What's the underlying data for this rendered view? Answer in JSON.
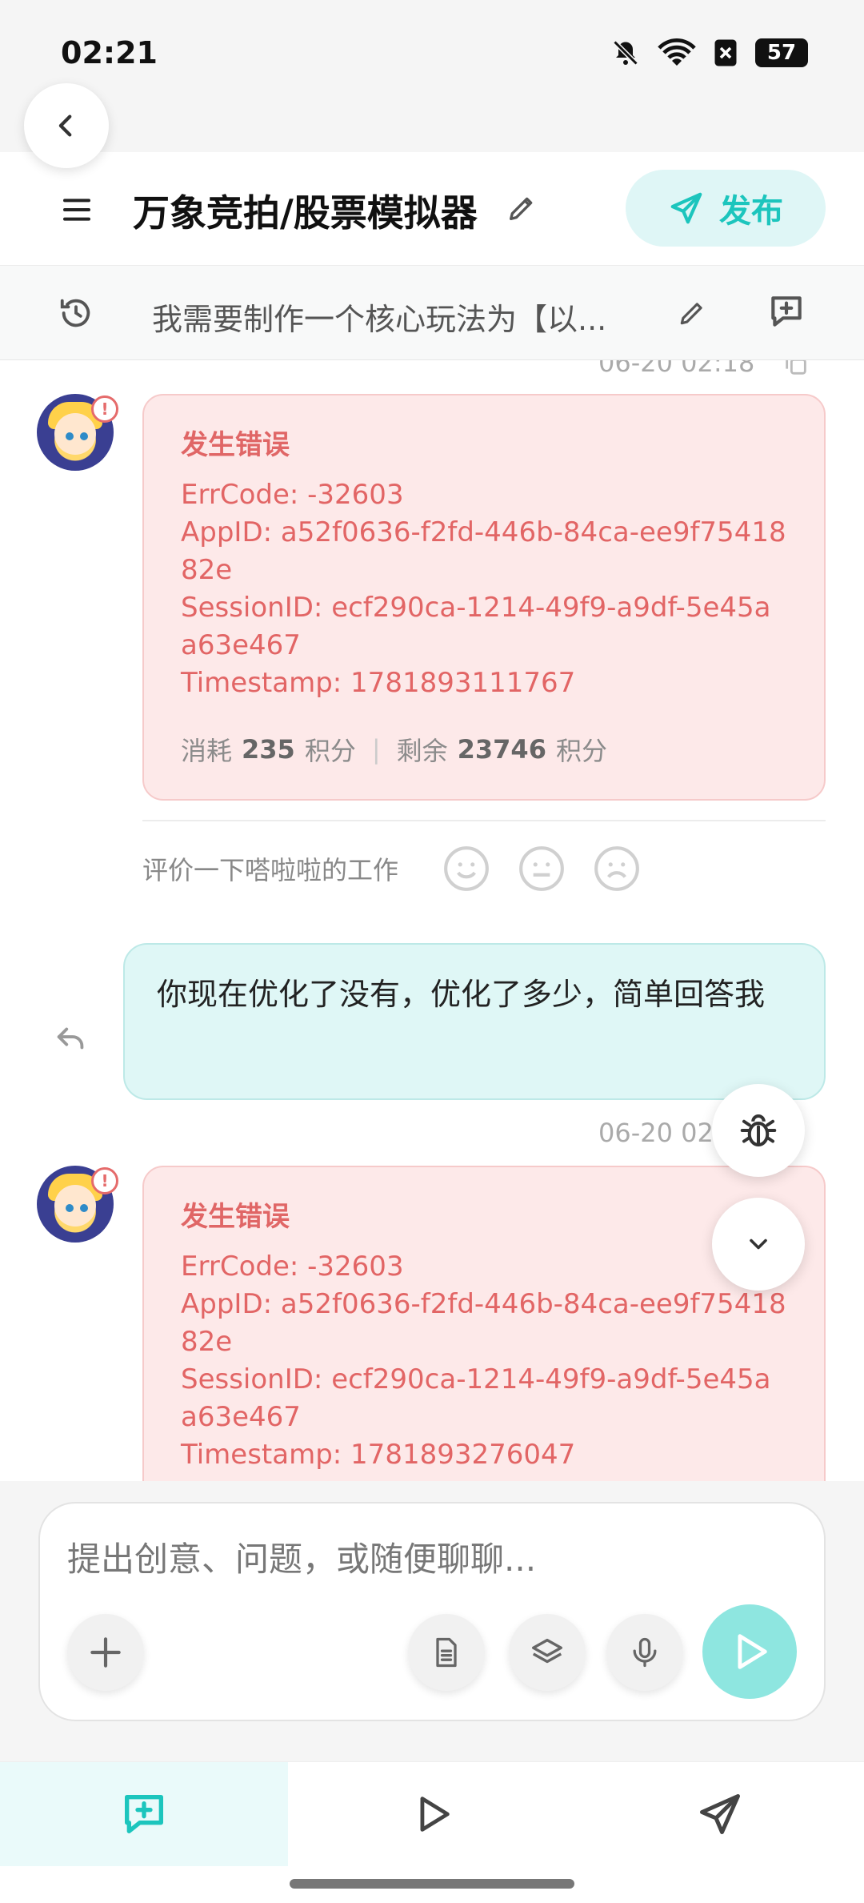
{
  "status_bar": {
    "time": "02:21",
    "battery": "57"
  },
  "header": {
    "title": "万象竞拍/股票模拟器",
    "publish_label": "发布"
  },
  "subheader": {
    "prompt_preview": "我需要制作一个核心玩法为【以..."
  },
  "messages": {
    "top_timestamp": "06-20 02:18",
    "error1": {
      "title": "发生错误",
      "lines": [
        "ErrCode: -32603",
        "AppID: a52f0636-f2fd-446b-84ca-ee9f7541882e",
        "SessionID: ecf290ca-1214-49f9-a9df-5e45aa63e467",
        "Timestamp: 1781893111767"
      ],
      "cost_prefix": "消耗",
      "cost_value": "235",
      "cost_unit": "积分",
      "remain_prefix": "剩余",
      "remain_value": "23746",
      "remain_unit": "积分"
    },
    "rating_label": "评价一下嗒啦啦的工作",
    "user_message": "你现在优化了没有，优化了多少，简单回答我",
    "second_timestamp": "06-20 02",
    "error2": {
      "title": "发生错误",
      "lines": [
        "ErrCode: -32603",
        "AppID: a52f0636-f2fd-446b-84ca-ee9f7541882e",
        "SessionID: ecf290ca-1214-49f9-a9df-5e45aa63e467",
        "Timestamp: 1781893276047"
      ]
    }
  },
  "input": {
    "placeholder": "提出创意、问题，或随便聊聊..."
  },
  "colors": {
    "accent": "#1cc5bd",
    "error": "#e26565",
    "error_bg": "#fde9e9"
  },
  "icons": [
    "back-icon",
    "menu-icon",
    "edit-icon",
    "send-icon",
    "history-icon",
    "new-chat-icon",
    "copy-icon",
    "bug-icon",
    "chevron-down-icon",
    "plus-icon",
    "document-icon",
    "layers-icon",
    "mic-icon",
    "play-icon",
    "undo-icon"
  ]
}
